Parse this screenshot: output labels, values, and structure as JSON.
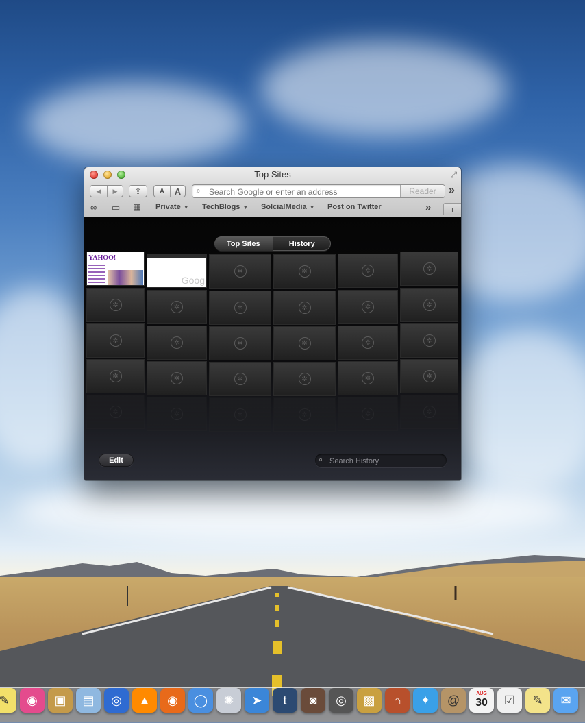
{
  "window": {
    "title": "Top Sites",
    "nav": {
      "back": "◀",
      "forward": "▶",
      "share": "⇪"
    },
    "text_small": "A",
    "text_large": "A",
    "address": {
      "placeholder": "Search Google or enter an address",
      "value": ""
    },
    "reader_label": "Reader",
    "overflow": "»",
    "bookmarks": [
      {
        "label": "Private",
        "dropdown": true
      },
      {
        "label": "TechBlogs",
        "dropdown": true
      },
      {
        "label": "SolcialMedia",
        "dropdown": true
      },
      {
        "label": "Post on Twitter",
        "dropdown": false
      }
    ],
    "bookmark_icons": [
      "reading-list-icon",
      "bookmarks-book-icon",
      "top-sites-grid-icon"
    ],
    "new_tab": "+"
  },
  "topsites": {
    "tabs": [
      {
        "label": "Top Sites",
        "active": true
      },
      {
        "label": "History",
        "active": false
      }
    ],
    "thumbnails": [
      {
        "site": "yahoo",
        "logo_text": "YAHOO!"
      },
      {
        "site": "google",
        "logo_text": "Goog"
      }
    ],
    "edit_label": "Edit",
    "search_history_placeholder": "Search History"
  },
  "dock": {
    "items": [
      "stickies-icon",
      "color-picker-icon",
      "preview-icon",
      "image-capture-icon",
      "quicktime-icon",
      "vlc-icon",
      "firefox-icon",
      "chrome-icon",
      "safari-icon",
      "send-arrow-icon",
      "tumblr-icon",
      "photo-booth-icon",
      "camera-icon",
      "package-icon",
      "birdhouse-icon",
      "twitter-icon",
      "address-book-icon",
      "calendar-icon",
      "reminders-icon",
      "notes-icon",
      "messages-icon"
    ],
    "calendar_month": "AUG",
    "calendar_day": "30"
  }
}
